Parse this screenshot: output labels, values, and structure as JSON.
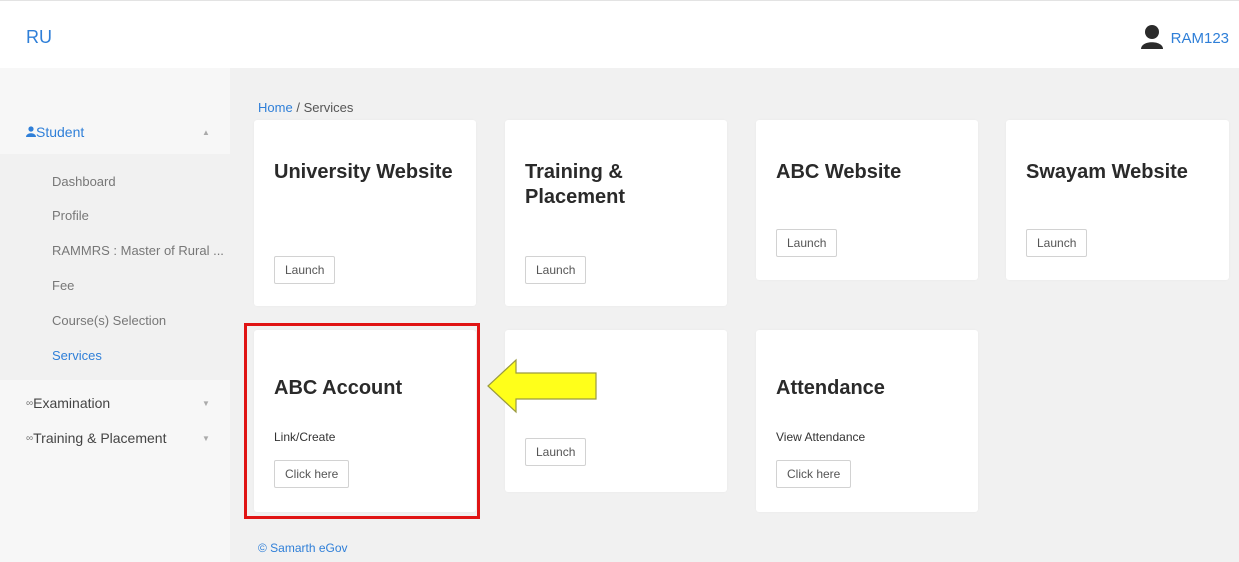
{
  "header": {
    "brand": "RU",
    "username": "RAM123"
  },
  "sidebar": {
    "sections": [
      {
        "label": "Student",
        "icon": "person-icon",
        "expanded": true
      },
      {
        "label": "Examination",
        "icon": "group-icon",
        "expanded": false
      },
      {
        "label": "Training & Placement",
        "icon": "group-icon",
        "expanded": false
      }
    ],
    "items": [
      {
        "label": "Dashboard",
        "active": false
      },
      {
        "label": "Profile",
        "active": false
      },
      {
        "label": "RAMMRS : Master of Rural ...",
        "active": false
      },
      {
        "label": "Fee",
        "active": false
      },
      {
        "label": "Course(s) Selection",
        "active": false
      },
      {
        "label": "Services",
        "active": true
      }
    ]
  },
  "breadcrumb": {
    "home": "Home",
    "separator": "/",
    "current": "Services"
  },
  "cards": [
    {
      "title": "University Website",
      "subtitle": "",
      "button": "Launch"
    },
    {
      "title": "Training & Placement",
      "subtitle": "",
      "button": "Launch"
    },
    {
      "title": "ABC Website",
      "subtitle": "",
      "button": "Launch"
    },
    {
      "title": "Swayam Website",
      "subtitle": "",
      "button": "Launch"
    },
    {
      "title": "ABC Account",
      "subtitle": "Link/Create",
      "button": "Click here"
    },
    {
      "title": "",
      "subtitle": "",
      "button": "Launch"
    },
    {
      "title": "Attendance",
      "subtitle": "View Attendance",
      "button": "Click here"
    }
  ],
  "footer": {
    "text": "© Samarth eGov"
  },
  "colors": {
    "accent": "#2f7fd8",
    "highlight_border": "#e01414",
    "arrow_fill": "#ffff1a"
  }
}
